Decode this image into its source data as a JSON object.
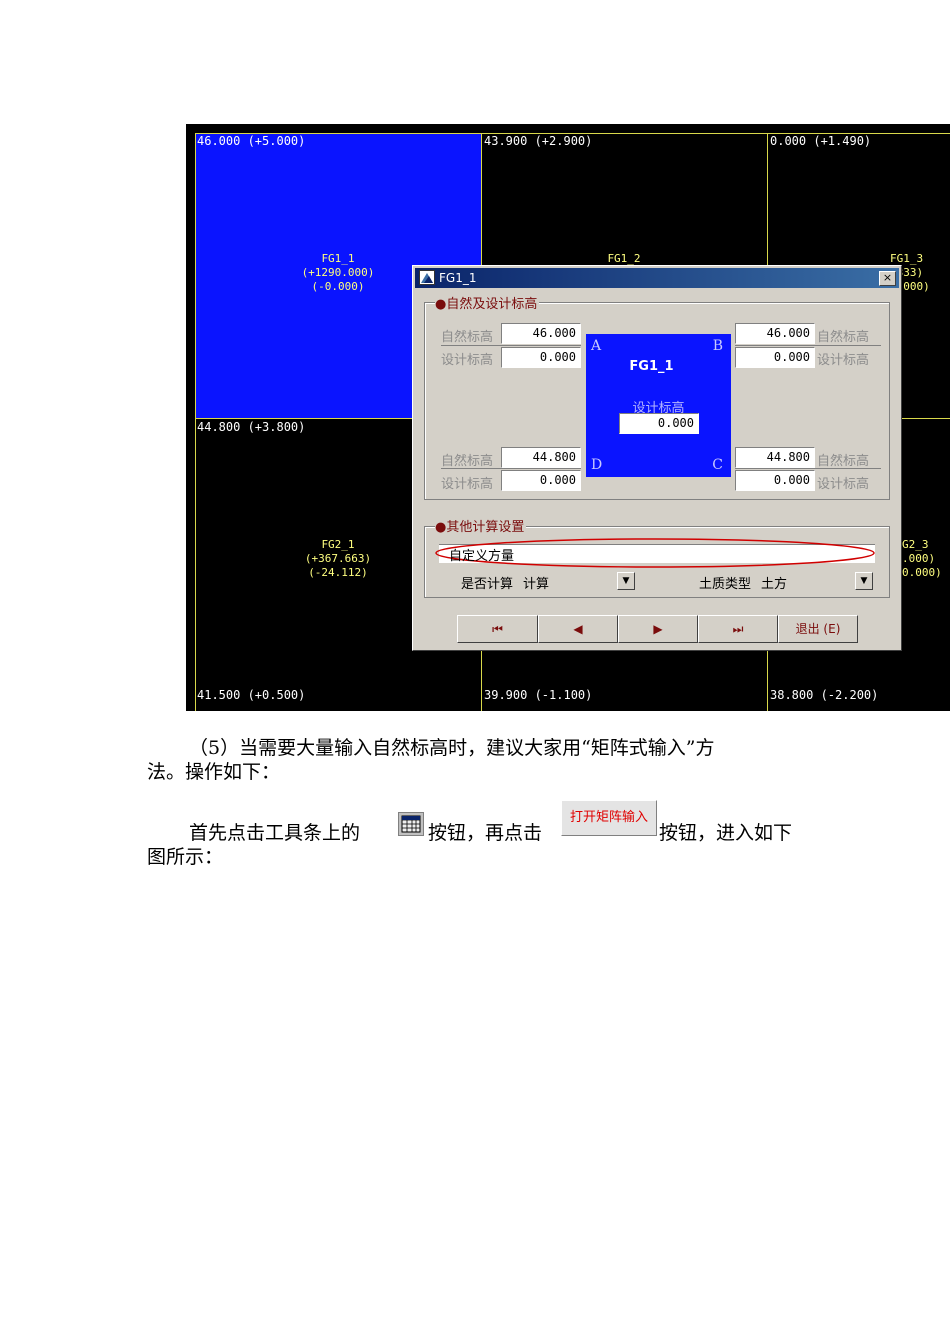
{
  "grid": {
    "corners": {
      "top_left": "46.000 (+5.000)",
      "top_mid": "43.900 (+2.900)",
      "top_right": "0.000 (+1.490)",
      "mid_left": "44.800 (+3.800)",
      "bottom_left": "41.500 (+0.500)",
      "bottom_mid": "39.900 (-1.100)",
      "bottom_right": "38.800 (-2.200)"
    },
    "cells": {
      "fg1_1": {
        "name": "FG1_1",
        "v1": "(+1290.000)",
        "v2": "(-0.000)"
      },
      "fg1_2": {
        "name": "FG1_2"
      },
      "fg1_3": {
        "name": "FG1_3",
        "v1": ".333)",
        "v2": "0.000)"
      },
      "fg2_1": {
        "name": "FG2_1",
        "v1": "(+367.663)",
        "v2": "(-24.112)"
      },
      "fg2_3": {
        "name": "G2_3",
        "v1": ".000)",
        "v2": "0.000)"
      }
    }
  },
  "dialog": {
    "title": "FG1_1",
    "close": "×",
    "section1_title": "●自然及设计标高",
    "natural_label": "自然标高",
    "design_label": "设计标高",
    "a_natural": "46.000",
    "a_design": "0.000",
    "b_natural": "46.000",
    "b_design": "0.000",
    "d_natural": "44.800",
    "d_design": "0.000",
    "c_natural": "44.800",
    "c_design": "0.000",
    "corner_a": "A",
    "corner_b": "B",
    "corner_c": "C",
    "corner_d": "D",
    "center_name": "FG1_1",
    "center_design_label": "设计标高",
    "center_design_value": "0.000",
    "section2_title": "●其他计算设置",
    "custom_label": "自定义方量",
    "calc_label": "是否计算",
    "calc_value": "计算",
    "soil_label": "土质类型",
    "soil_value": "土方",
    "dropdown_arrow": "▼",
    "nav": {
      "first": "⏮",
      "prev": "◀",
      "next": "▶",
      "last": "⏭",
      "exit": "退出 (E)"
    }
  },
  "text": {
    "para1_line1": "（5）当需要大量输入自然标高时，建议大家用“矩阵式输入”方",
    "para1_line2": "法。操作如下：",
    "para2_a": "首先点击工具条上的",
    "para2_b": "按钮，再点击",
    "para2_c": "按钮，进入如下",
    "para2_line2": "图所示：",
    "matrix_button": "打开矩阵输入"
  }
}
